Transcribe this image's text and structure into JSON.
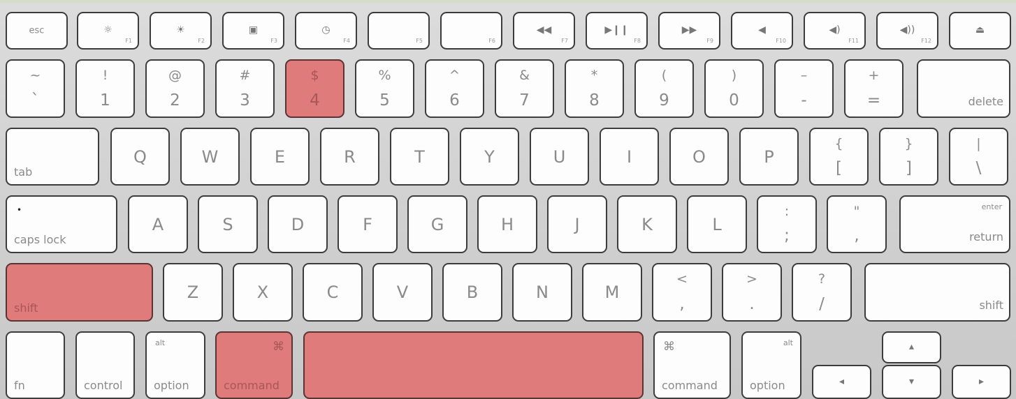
{
  "highlight_color": "#e07b7b",
  "rows": [
    [
      {
        "main": "esc"
      },
      {
        "icon": "brightness-down-icon",
        "glyph": "☼",
        "fx": "F1"
      },
      {
        "icon": "brightness-up-icon",
        "glyph": "☀",
        "fx": "F2"
      },
      {
        "icon": "expose-icon",
        "glyph": "▣",
        "fx": "F3"
      },
      {
        "icon": "dashboard-icon",
        "glyph": "◷",
        "fx": "F4"
      },
      {
        "fx": "F5"
      },
      {
        "fx": "F6"
      },
      {
        "icon": "rewind-icon",
        "glyph": "◀◀",
        "fx": "F7"
      },
      {
        "icon": "play-pause-icon",
        "glyph": "▶❙❙",
        "fx": "F8"
      },
      {
        "icon": "fast-forward-icon",
        "glyph": "▶▶",
        "fx": "F9"
      },
      {
        "icon": "mute-icon",
        "glyph": "◀",
        "fx": "F10"
      },
      {
        "icon": "volume-down-icon",
        "glyph": "◀)",
        "fx": "F11"
      },
      {
        "icon": "volume-up-icon",
        "glyph": "◀))",
        "fx": "F12"
      },
      {
        "icon": "eject-icon",
        "glyph": "⏏"
      }
    ],
    [
      {
        "top": "~",
        "bottom": "`"
      },
      {
        "top": "!",
        "bottom": "1"
      },
      {
        "top": "@",
        "bottom": "2"
      },
      {
        "top": "#",
        "bottom": "3"
      },
      {
        "top": "$",
        "bottom": "4",
        "highlighted": true
      },
      {
        "top": "%",
        "bottom": "5"
      },
      {
        "top": "^",
        "bottom": "6"
      },
      {
        "top": "&",
        "bottom": "7"
      },
      {
        "top": "*",
        "bottom": "8"
      },
      {
        "top": "(",
        "bottom": "9"
      },
      {
        "top": ")",
        "bottom": "0"
      },
      {
        "top": "–",
        "bottom": "-"
      },
      {
        "top": "+",
        "bottom": "="
      },
      {
        "label": "delete"
      }
    ],
    [
      {
        "label": "tab"
      },
      {
        "main": "Q"
      },
      {
        "main": "W"
      },
      {
        "main": "E"
      },
      {
        "main": "R"
      },
      {
        "main": "T"
      },
      {
        "main": "Y"
      },
      {
        "main": "U"
      },
      {
        "main": "I"
      },
      {
        "main": "O"
      },
      {
        "main": "P"
      },
      {
        "top": "{",
        "bottom": "["
      },
      {
        "top": "}",
        "bottom": "]"
      },
      {
        "top": "|",
        "bottom": "\\"
      }
    ],
    [
      {
        "label": "caps lock",
        "indicator": "•"
      },
      {
        "main": "A"
      },
      {
        "main": "S"
      },
      {
        "main": "D"
      },
      {
        "main": "F"
      },
      {
        "main": "G"
      },
      {
        "main": "H"
      },
      {
        "main": "J"
      },
      {
        "main": "K"
      },
      {
        "main": "L"
      },
      {
        "top": ":",
        "bottom": ";"
      },
      {
        "top": "\"",
        "bottom": ","
      },
      {
        "label": "return",
        "corner": "enter"
      }
    ],
    [
      {
        "label": "shift",
        "highlighted": true
      },
      {
        "main": "Z"
      },
      {
        "main": "X"
      },
      {
        "main": "C"
      },
      {
        "main": "V"
      },
      {
        "main": "B"
      },
      {
        "main": "N"
      },
      {
        "main": "M"
      },
      {
        "top": "<",
        "bottom": ","
      },
      {
        "top": ">",
        "bottom": "."
      },
      {
        "top": "?",
        "bottom": "/"
      },
      {
        "label": "shift"
      }
    ],
    [
      {
        "label": "fn"
      },
      {
        "label": "control"
      },
      {
        "label": "option",
        "corner": "alt"
      },
      {
        "label": "command",
        "corner": "⌘",
        "highlighted": true
      },
      {
        "label": "",
        "name": "space",
        "highlighted": true
      },
      {
        "label": "command",
        "corner": "⌘"
      },
      {
        "label": "option",
        "corner": "alt"
      },
      {
        "icon": "arrow-left-icon",
        "glyph": "◂"
      },
      {
        "icon": "arrow-up-icon",
        "glyph": "▴"
      },
      {
        "icon": "arrow-down-icon",
        "glyph": "▾"
      },
      {
        "icon": "arrow-right-icon",
        "glyph": "▸"
      }
    ]
  ]
}
